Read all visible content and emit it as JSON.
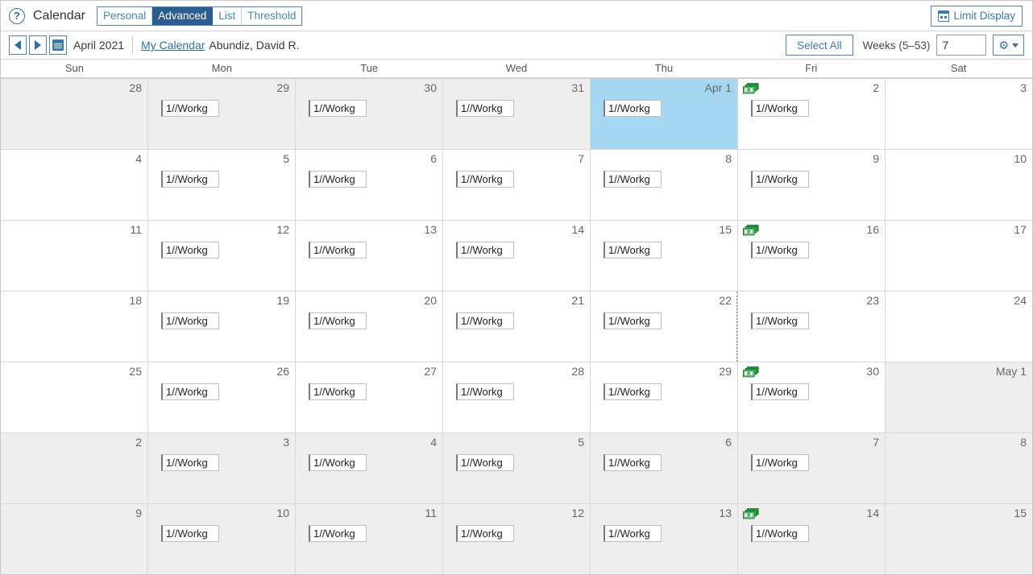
{
  "titlebar": {
    "help_icon": "help-circle-icon",
    "title": "Calendar",
    "tabs": [
      {
        "label": "Personal",
        "active": false
      },
      {
        "label": "Advanced",
        "active": true
      },
      {
        "label": "List",
        "active": false
      },
      {
        "label": "Threshold",
        "active": false
      }
    ],
    "limit_display_label": "Limit Display",
    "limit_display_icon": "calendar-icon"
  },
  "toolbar": {
    "prev_icon": "chevron-left-icon",
    "next_icon": "chevron-right-icon",
    "calendar_picker_icon": "calendar-icon",
    "month_label": "April 2021",
    "my_calendar_link": "My Calendar",
    "owner_name": "Abundiz, David R.",
    "select_all_label": "Select All",
    "weeks_label": "Weeks (5–53)",
    "weeks_value": "7",
    "gear_icon": "gear-icon",
    "caret_icon": "chevron-down-icon"
  },
  "calendar": {
    "weekdays": [
      "Sun",
      "Mon",
      "Tue",
      "Wed",
      "Thu",
      "Fri",
      "Sat"
    ],
    "event_label": "1//Workg",
    "money_icon_name": "payday-money-icon",
    "colors": {
      "selected_day_bg": "#a5d7f2",
      "other_month_bg": "#eeeeee",
      "current_month_bg": "#ffffff",
      "accent_blue": "#2f6fa8",
      "active_tab_bg": "#2c5d8f",
      "money_icon_green": "#1a9e2e",
      "dotted_divider": "#e2571e"
    },
    "weeks": [
      {
        "other_month": true,
        "days": [
          {
            "num": "28",
            "event": false,
            "money": false
          },
          {
            "num": "29",
            "event": true,
            "money": false
          },
          {
            "num": "30",
            "event": true,
            "money": false
          },
          {
            "num": "31",
            "event": true,
            "money": false
          },
          {
            "num": "Apr 1",
            "event": true,
            "money": false,
            "selected": true,
            "current_month": true
          },
          {
            "num": "2",
            "event": true,
            "money": true,
            "current_month": true
          },
          {
            "num": "3",
            "event": false,
            "money": false,
            "current_month": true
          }
        ]
      },
      {
        "other_month": false,
        "days": [
          {
            "num": "4",
            "event": false,
            "money": false
          },
          {
            "num": "5",
            "event": true,
            "money": false
          },
          {
            "num": "6",
            "event": true,
            "money": false
          },
          {
            "num": "7",
            "event": true,
            "money": false
          },
          {
            "num": "8",
            "event": true,
            "money": false
          },
          {
            "num": "9",
            "event": true,
            "money": false
          },
          {
            "num": "10",
            "event": false,
            "money": false
          }
        ]
      },
      {
        "other_month": false,
        "days": [
          {
            "num": "11",
            "event": false,
            "money": false
          },
          {
            "num": "12",
            "event": true,
            "money": false
          },
          {
            "num": "13",
            "event": true,
            "money": false
          },
          {
            "num": "14",
            "event": true,
            "money": false
          },
          {
            "num": "15",
            "event": true,
            "money": false
          },
          {
            "num": "16",
            "event": true,
            "money": true
          },
          {
            "num": "17",
            "event": false,
            "money": false
          }
        ]
      },
      {
        "other_month": false,
        "divider_after_index": 4,
        "days": [
          {
            "num": "18",
            "event": false,
            "money": false
          },
          {
            "num": "19",
            "event": true,
            "money": false
          },
          {
            "num": "20",
            "event": true,
            "money": false
          },
          {
            "num": "21",
            "event": true,
            "money": false
          },
          {
            "num": "22",
            "event": true,
            "money": false
          },
          {
            "num": "23",
            "event": true,
            "money": false
          },
          {
            "num": "24",
            "event": false,
            "money": false
          }
        ]
      },
      {
        "other_month": false,
        "days": [
          {
            "num": "25",
            "event": false,
            "money": false
          },
          {
            "num": "26",
            "event": true,
            "money": false
          },
          {
            "num": "27",
            "event": true,
            "money": false
          },
          {
            "num": "28",
            "event": true,
            "money": false
          },
          {
            "num": "29",
            "event": true,
            "money": false
          },
          {
            "num": "30",
            "event": true,
            "money": true
          },
          {
            "num": "May 1",
            "event": false,
            "money": false,
            "other_month": true
          }
        ]
      },
      {
        "other_month": true,
        "days": [
          {
            "num": "2",
            "event": false,
            "money": false
          },
          {
            "num": "3",
            "event": true,
            "money": false
          },
          {
            "num": "4",
            "event": true,
            "money": false
          },
          {
            "num": "5",
            "event": true,
            "money": false
          },
          {
            "num": "6",
            "event": true,
            "money": false
          },
          {
            "num": "7",
            "event": true,
            "money": false
          },
          {
            "num": "8",
            "event": false,
            "money": false
          }
        ]
      },
      {
        "other_month": true,
        "days": [
          {
            "num": "9",
            "event": false,
            "money": false
          },
          {
            "num": "10",
            "event": true,
            "money": false
          },
          {
            "num": "11",
            "event": true,
            "money": false
          },
          {
            "num": "12",
            "event": true,
            "money": false
          },
          {
            "num": "13",
            "event": true,
            "money": false
          },
          {
            "num": "14",
            "event": true,
            "money": true
          },
          {
            "num": "15",
            "event": false,
            "money": false
          }
        ]
      }
    ]
  }
}
